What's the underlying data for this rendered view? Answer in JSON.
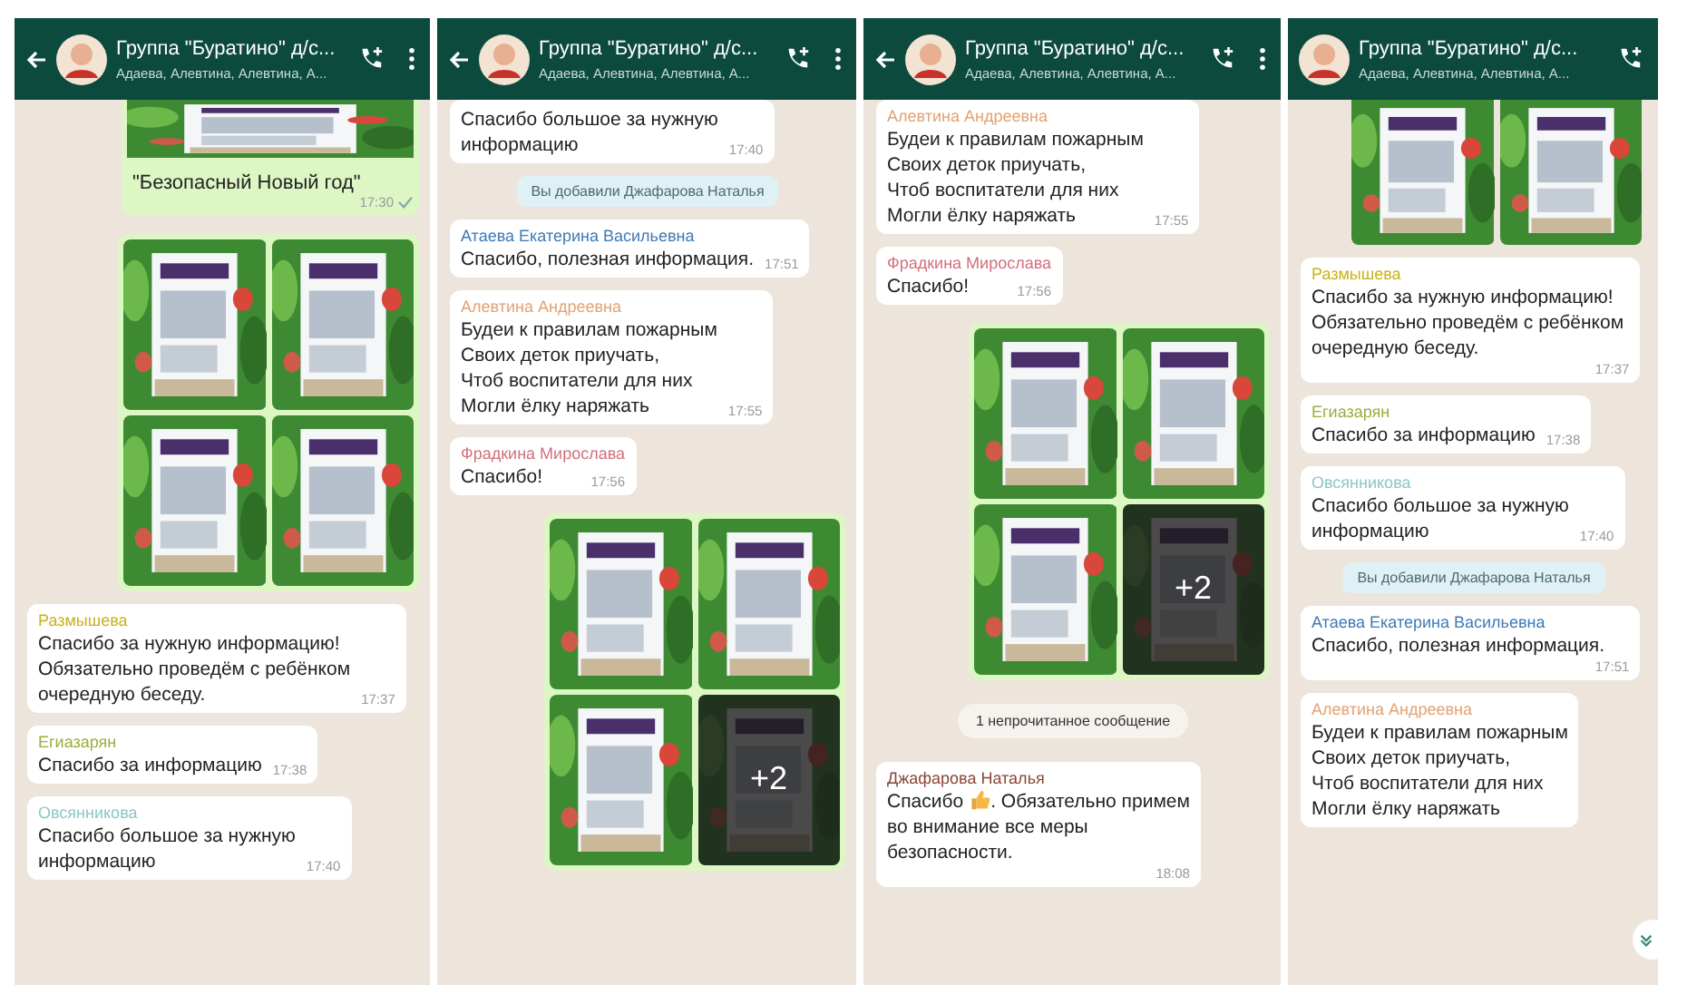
{
  "panels": [
    {
      "header": {
        "title": "Группа \"Буратино\" д/с...",
        "subtitle": "Адаева, Алевтина, Алевтина, А...",
        "back_arrow": true,
        "menu": true
      },
      "scroll_button": false,
      "messages": [
        {
          "caption": "\"Безопасный Новый год\"",
          "time": "17:30"
        },
        {
          "kind": "album"
        },
        {
          "kind": "incoming",
          "sender": "Размышева",
          "color": "#c9b21a",
          "text": "Спасибо за нужную информацию!\nОбязательно проведём с ребёнком\nочередную беседу.",
          "time": "17:37"
        },
        {
          "kind": "incoming",
          "sender": "Егиазарян",
          "color": "#9aae3c",
          "text": "Спасибо за информацию",
          "time": "17:38"
        },
        {
          "kind": "incoming",
          "sender": "Овсянникова",
          "color": "#8cc6cc",
          "text": "Спасибо большое за нужную\nинформацию",
          "time": "17:40"
        }
      ]
    },
    {
      "header": {
        "title": "Группа \"Буратино\" д/с...",
        "subtitle": "Адаева, Алевтина, Алевтина, А...",
        "back_arrow": true,
        "menu": true
      },
      "scroll_button": false,
      "messages": [
        {
          "kind": "incoming",
          "text": "Спасибо большое за нужную\nинформацию",
          "time": "17:40"
        },
        {
          "kind": "system",
          "text": "Вы добавили Джафарова Наталья"
        },
        {
          "kind": "incoming",
          "sender": "Атаева Екатерина Васильевна",
          "color": "#3d7bb5",
          "text": "Спасибо, полезная информация.",
          "time": "17:51"
        },
        {
          "kind": "incoming",
          "sender": "Алевтина Андреевна",
          "color": "#e3a272",
          "text": "Будеи к правилам пожарным\nСвоих деток приучать,\nЧтоб воспитатели для них\nМогли ёлку наряжать",
          "time": "17:55"
        },
        {
          "kind": "incoming",
          "sender": "Фрадкина Мирослава",
          "color": "#d2707c",
          "text": "Спасибо!",
          "time": "17:56"
        },
        {
          "kind": "album",
          "more": "+2"
        }
      ]
    },
    {
      "header": {
        "title": "Группа \"Буратино\" д/с...",
        "subtitle": "Адаева, Алевтина, Алевтина, А...",
        "back_arrow": true,
        "menu": true
      },
      "scroll_button": false,
      "messages": [
        {
          "kind": "incoming",
          "sender": "Алевтина Андреевна",
          "color": "#e3a272",
          "text": "Будеи к правилам пожарным\nСвоих деток приучать,\nЧтоб воспитатели для них\nМогли ёлку наряжать",
          "time": "17:55"
        },
        {
          "kind": "incoming",
          "sender": "Фрадкина Мирослава",
          "color": "#d2707c",
          "text": "Спасибо!",
          "time": "17:56"
        },
        {
          "kind": "album",
          "more": "+2"
        },
        {
          "kind": "unread",
          "text": "1 непрочитанное сообщение"
        },
        {
          "kind": "incoming",
          "sender": "Джафарова Наталья",
          "color": "#8a4636",
          "text": "Спасибо",
          "thumbs_up": true,
          "text_after": ". Обязательно примем",
          "text_more": "во внимание все меры\nбезопасности.",
          "time": "18:08"
        }
      ]
    },
    {
      "header": {
        "title": "Группа \"Буратино\" д/с...",
        "subtitle": "Адаева, Алевтина, Алевтина, А...",
        "back_arrow": false,
        "menu": false
      },
      "scroll_button": true,
      "messages": [
        {
          "kind": "album_partial"
        },
        {
          "kind": "incoming",
          "sender": "Размышева",
          "color": "#c9b21a",
          "text": "Спасибо за нужную информацию!\nОбязательно проведём с ребёнком\nочередную беседу.",
          "time": "17:37"
        },
        {
          "kind": "incoming",
          "sender": "Егиазарян",
          "color": "#9aae3c",
          "text": "Спасибо за информацию",
          "time": "17:38"
        },
        {
          "kind": "incoming",
          "sender": "Овсянникова",
          "color": "#8cc6cc",
          "text": "Спасибо большое за нужную\nинформацию",
          "time": "17:40"
        },
        {
          "kind": "system",
          "text": "Вы добавили Джафарова Наталья"
        },
        {
          "kind": "incoming",
          "sender": "Атаева Екатерина Васильевна",
          "color": "#3d7bb5",
          "text": "Спасибо, полезная информация.",
          "time": "17:51"
        },
        {
          "kind": "incoming",
          "sender": "Алевтина Андреевна",
          "color": "#e3a272",
          "text": "Будеи к правилам пожарным\nСвоих деток приучать,\nЧтоб воспитатели для них\nМогли ёлку наряжать"
        }
      ]
    }
  ]
}
